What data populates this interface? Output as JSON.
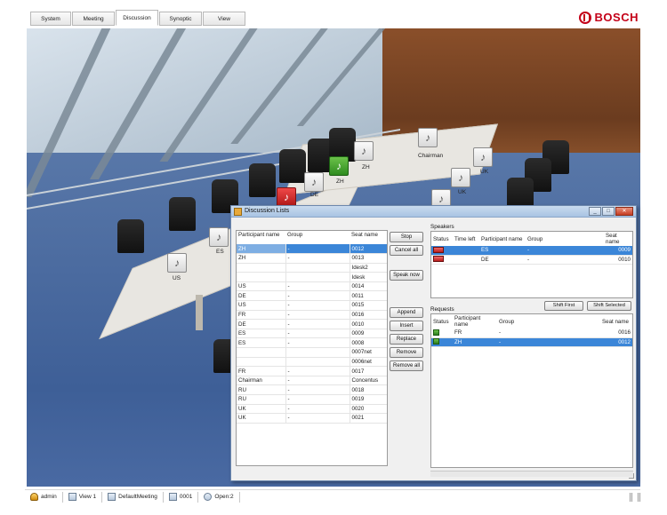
{
  "brand": "BOSCH",
  "nav": {
    "tabs": [
      {
        "label": "System"
      },
      {
        "label": "Meeting"
      },
      {
        "label": "Discussion"
      },
      {
        "label": "Synoptic"
      },
      {
        "label": "View"
      }
    ],
    "active": "Discussion"
  },
  "scene": {
    "seat_labels": [
      "ZH",
      "ZH",
      "DE",
      "Chairman",
      "UK",
      "UK",
      "ES",
      "US"
    ]
  },
  "dialog": {
    "title": "Discussion Lists",
    "left_list": {
      "columns": [
        "Participant name",
        "Group",
        "Seat name"
      ],
      "rows": [
        {
          "name": "ZH",
          "group": "-",
          "seat": "0012",
          "selected": true
        },
        {
          "name": "ZH",
          "group": "-",
          "seat": "0013"
        },
        {
          "name": "",
          "group": "",
          "seat": "Idesk2"
        },
        {
          "name": "",
          "group": "",
          "seat": "Idesk"
        },
        {
          "name": "US",
          "group": "-",
          "seat": "0014"
        },
        {
          "name": "DE",
          "group": "-",
          "seat": "0011"
        },
        {
          "name": "US",
          "group": "-",
          "seat": "0015"
        },
        {
          "name": "FR",
          "group": "-",
          "seat": "0016"
        },
        {
          "name": "DE",
          "group": "-",
          "seat": "0010"
        },
        {
          "name": "ES",
          "group": "-",
          "seat": "0009"
        },
        {
          "name": "ES",
          "group": "-",
          "seat": "0008"
        },
        {
          "name": "",
          "group": "",
          "seat": "0007net"
        },
        {
          "name": "",
          "group": "",
          "seat": "0006net"
        },
        {
          "name": "FR",
          "group": "-",
          "seat": "0017"
        },
        {
          "name": "Chairman",
          "group": "-",
          "seat": "Concentus"
        },
        {
          "name": "RU",
          "group": "-",
          "seat": "0018"
        },
        {
          "name": "RU",
          "group": "-",
          "seat": "0019"
        },
        {
          "name": "UK",
          "group": "-",
          "seat": "0020"
        },
        {
          "name": "UK",
          "group": "-",
          "seat": "0021"
        }
      ]
    },
    "buttons": {
      "stop": "Stop",
      "cancel_all": "Cancel all",
      "speak_now": "Speak now",
      "append": "Append",
      "insert": "Insert",
      "replace": "Replace",
      "remove": "Remove",
      "remove_all": "Remove all",
      "shift_first": "Shift First",
      "shift_selected": "Shift Selected"
    },
    "speakers": {
      "label": "Speakers",
      "columns": [
        "Status",
        "Time left",
        "Participant name",
        "Group",
        "Seat name"
      ],
      "rows": [
        {
          "status": "red",
          "time_left": "",
          "name": "ES",
          "group": "-",
          "seat": "0009",
          "selected": true
        },
        {
          "status": "red",
          "time_left": "",
          "name": "DE",
          "group": "-",
          "seat": "0010"
        }
      ]
    },
    "requests": {
      "label": "Requests",
      "columns": [
        "Status",
        "Participant name",
        "Group",
        "Seat name"
      ],
      "rows": [
        {
          "status": "green",
          "name": "FR",
          "group": "-",
          "seat": "0016"
        },
        {
          "status": "green",
          "name": "ZH",
          "group": "-",
          "seat": "0012",
          "selected": true
        }
      ]
    }
  },
  "statusbar": {
    "user": "admin",
    "view": "View 1",
    "meeting": "DefaultMeeting",
    "count": "0001",
    "open": "Open:2"
  }
}
